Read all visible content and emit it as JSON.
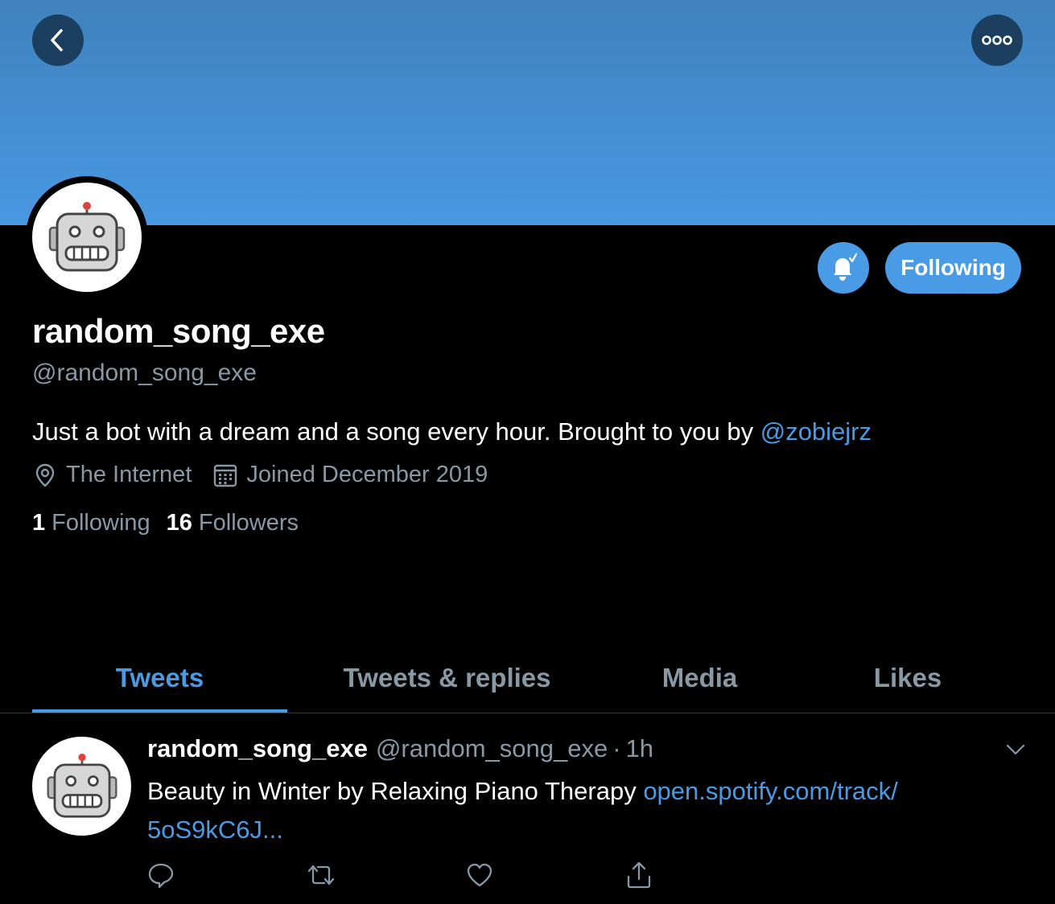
{
  "header": {
    "back_icon": "chevron-left-icon",
    "more_icon": "more-horizontal-icon",
    "banner_color": "#4898e2"
  },
  "profile": {
    "avatar_icon": "robot-face-icon",
    "display_name": "random_song_exe",
    "handle": "@random_song_exe",
    "bio_text": "Just a bot with a dream and a song every hour. Brought to you by ",
    "bio_mention": "@zobiejrz",
    "location": "The Internet",
    "location_icon": "location-pin-icon",
    "joined": "Joined December 2019",
    "joined_icon": "calendar-icon",
    "following_count": "1",
    "following_label": "Following",
    "followers_count": "16",
    "followers_label": "Followers"
  },
  "actions": {
    "notify_icon": "bell-check-icon",
    "follow_label": "Following",
    "accent_color": "#4a9be6"
  },
  "tabs": [
    {
      "label": "Tweets",
      "active": true
    },
    {
      "label": "Tweets & replies",
      "active": false
    },
    {
      "label": "Media",
      "active": false
    },
    {
      "label": "Likes",
      "active": false
    }
  ],
  "tweet": {
    "name": "random_song_exe",
    "handle": "@random_song_exe",
    "dot": "·",
    "time": "1h",
    "text": "Beauty in Winter by Relaxing Piano Therapy ",
    "link": "open.spotify.com/track/\n5oS9kC6J...",
    "link_line1": "open.spotify.com/track/",
    "link_line2": "5oS9kC6J...",
    "action_icons": [
      "reply-icon",
      "retweet-icon",
      "like-icon",
      "share-icon"
    ]
  }
}
